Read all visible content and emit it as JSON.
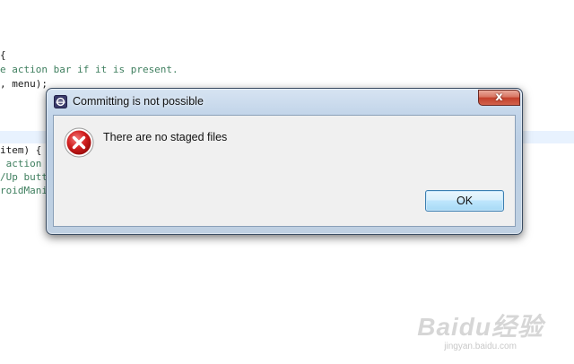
{
  "editor": {
    "lines": [
      {
        "text": "{",
        "color": "#1a1a1a"
      },
      {
        "text": "e action bar if it is present.",
        "color": "#3f7f5f"
      },
      {
        "text": ", menu);",
        "color": "#1a1a1a"
      },
      {
        "text": "item) {",
        "color": "#1a1a1a"
      },
      {
        "text": " action",
        "color": "#3f7f5f"
      },
      {
        "text": "/Up butt",
        "color": "#3f7f5f"
      },
      {
        "text": "roidMani",
        "color": "#3f7f5f"
      }
    ]
  },
  "dialog": {
    "title": "Committing is not possible",
    "close_label": "x",
    "message": "There are no staged files",
    "ok_label": "OK",
    "icon": "error-icon",
    "app_icon": "eclipse-icon"
  },
  "watermark": {
    "logo": "Baidu经验",
    "url": "jingyan.baidu.com"
  },
  "colors": {
    "code_green": "#3f7f5f",
    "line_highlight": "#e8f2fe",
    "dialog_frame": "#bfd0e2",
    "error_red": "#c8102e"
  }
}
